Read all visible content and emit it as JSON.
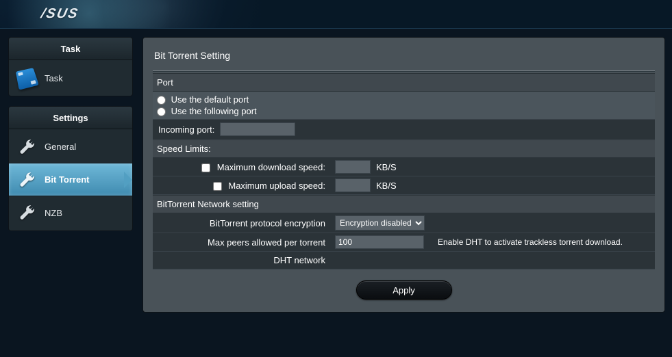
{
  "brand": "/SUS",
  "sidebar": {
    "task_header": "Task",
    "task_item": "Task",
    "settings_header": "Settings",
    "items": [
      {
        "label": "General"
      },
      {
        "label": "Bit Torrent"
      },
      {
        "label": "NZB"
      }
    ]
  },
  "page": {
    "title": "Bit Torrent Setting",
    "port": {
      "header": "Port",
      "use_default": "Use the default port",
      "use_following": "Use the following port",
      "incoming_label": "Incoming port:",
      "incoming_value": ""
    },
    "speed": {
      "header": "Speed Limits:",
      "max_dl_label": "Maximum download speed:",
      "max_dl_value": "",
      "max_ul_label": "Maximum upload speed:",
      "max_ul_value": "",
      "unit": "KB/S"
    },
    "network": {
      "header": "BitTorrent Network setting",
      "enc_label": "BitTorrent protocol encryption",
      "enc_value": "Encryption disabled",
      "peers_label": "Max peers allowed per torrent",
      "peers_value": "100",
      "dht_label": "DHT network",
      "dht_note": "Enable DHT to activate trackless torrent download."
    },
    "apply": "Apply"
  }
}
